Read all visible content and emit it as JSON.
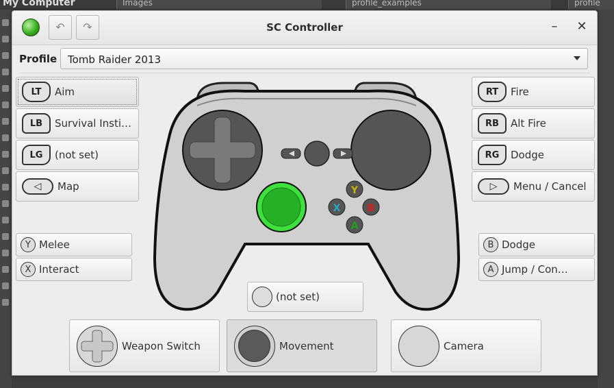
{
  "background": {
    "title": "My Computer",
    "tabs": [
      "Images",
      "profile_examples",
      "profile"
    ]
  },
  "window": {
    "title": "SC Controller",
    "minimize_glyph": "–",
    "close_glyph": "✕",
    "undo_glyph": "↶",
    "redo_glyph": "↷"
  },
  "profile": {
    "label": "Profile",
    "value": "Tomb Raider 2013"
  },
  "left_buttons": [
    {
      "key": "LT",
      "action": "Aim",
      "icon": "left-trigger-icon"
    },
    {
      "key": "LB",
      "action": "Survival Insti…",
      "icon": "left-bumper-icon"
    },
    {
      "key": "LG",
      "action": "(not set)",
      "icon": "left-grip-icon"
    },
    {
      "key": "◁",
      "action": "Map",
      "icon": "back-button-icon"
    }
  ],
  "right_buttons": [
    {
      "key": "RT",
      "action": "Fire",
      "icon": "right-trigger-icon"
    },
    {
      "key": "RB",
      "action": "Alt Fire",
      "icon": "right-bumper-icon"
    },
    {
      "key": "RG",
      "action": "Dodge",
      "icon": "right-grip-icon"
    },
    {
      "key": "▷",
      "action": "Menu / Cancel",
      "icon": "start-button-icon"
    }
  ],
  "face_left": [
    {
      "key": "Y",
      "action": "Melee"
    },
    {
      "key": "X",
      "action": "Interact"
    }
  ],
  "face_right": [
    {
      "key": "B",
      "action": "Dodge"
    },
    {
      "key": "A",
      "action": "Jump / Con…"
    }
  ],
  "stick_click": {
    "action": "(not set)"
  },
  "pads": {
    "left": {
      "action": "Weapon Switch",
      "icon": "dpad-icon"
    },
    "stick": {
      "action": "Movement",
      "icon": "stick-icon"
    },
    "right": {
      "action": "Camera",
      "icon": "right-pad-icon"
    }
  },
  "controller_face_labels": {
    "y": "Y",
    "x": "X",
    "b": "B",
    "a": "A"
  },
  "colors": {
    "stick_highlight": "#2db82d",
    "y_label": "#c8b400",
    "x_label": "#2aa8c8",
    "b_label": "#d42020",
    "a_label": "#1ea01e"
  }
}
